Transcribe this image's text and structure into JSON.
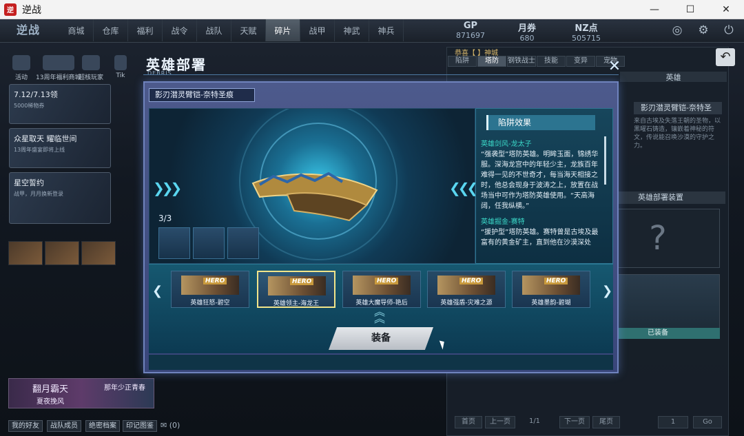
{
  "window": {
    "title": "逆战",
    "logo_text": "逆",
    "minimize": "—",
    "maximize": "☐",
    "close": "✕"
  },
  "game": {
    "brand": "逆战",
    "nav": [
      "商城",
      "仓库",
      "福利",
      "战令",
      "战队",
      "天赋",
      "碎片",
      "战甲",
      "神武",
      "神兵"
    ],
    "active_nav": "碎片",
    "currency": [
      {
        "label": "GP",
        "value": "871697"
      },
      {
        "label": "月券",
        "value": "680"
      },
      {
        "label": "NZ点",
        "value": "505715"
      }
    ],
    "quick_links": [
      "活动",
      "13周年福利商城",
      "超核玩家",
      "Tik"
    ],
    "promos": [
      {
        "title": "7.12/7.13领",
        "sub": "5000稀物券"
      },
      {
        "title": "众星取天 耀临世间",
        "sub": "13周年盛宴即将上线"
      },
      {
        "title": "星空誓约",
        "sub": "战甲，月月换新登录"
      }
    ],
    "bottom_banner": [
      "翻月霸天",
      "那年少正青春",
      "夏夜挽风"
    ],
    "social": [
      "我的好友",
      "战队成员",
      "绝密档案",
      "印记图鉴"
    ],
    "mail_count": "(0)"
  },
  "right_panel": {
    "tabs": [
      "陷阱",
      "塔防",
      "钢铁战士",
      "技能",
      "变异",
      "宠物"
    ],
    "active_tab": "塔防",
    "banner": "恭喜【 】神城",
    "hero_section": "英雄",
    "item_title": "影刃潜灵臂铠-奈特圣",
    "item_desc": "来自古埃及失落王朝的圣物，以黑曜石铸造，镶嵌着神秘的符文，传说能召唤沙漠的守护之力。",
    "deploy_title": "英雄部署装置",
    "unknown_slot": "?",
    "equipped": "已装备",
    "pager": [
      "首页",
      "上一页",
      "1/1",
      "下一页",
      "尾页",
      "1",
      "Go"
    ]
  },
  "modal": {
    "title": "英雄部署",
    "subtitle": "DEBRIS",
    "close": "✕",
    "item_name": "影刃潜灵臂铠-奈特圣痕",
    "counter": "3/3",
    "effect_title": "陷阱效果",
    "effects": [
      {
        "name": "英雄剑风-龙太子",
        "text": "“强袭型”塔防英雄。明眸玉面，锦绣华服。深海龙宫中的年轻少主，龙族百年难得一见的不世奇才，每当海天相接之时，他总会现身于波涛之上，放置在战场当中可作为塔防英雄使用。“天高海阔，任我纵横。”"
      },
      {
        "name": "英雄掘金-赛特",
        "text": "“援护型”塔防英雄。赛特曾是古埃及最富有的黄金矿主，直到他在沙漠深处"
      }
    ],
    "heroes": [
      {
        "label": "英雄狂怒-碧空",
        "tag": "HERO"
      },
      {
        "label": "英雄领主-海龙王",
        "tag": "HERO"
      },
      {
        "label": "英雄大魔导师-艳后",
        "tag": "HERO"
      },
      {
        "label": "英雄强盾-灾难之源",
        "tag": "HERO"
      },
      {
        "label": "英雄墨韵-碧瑚",
        "tag": "HERO"
      }
    ],
    "selected_hero": "英雄领主-海龙王",
    "equip_label": "装备"
  },
  "colors": {
    "accent": "#2c7490",
    "highlight": "#3ad7c7",
    "selected_border": "#f2e58a"
  }
}
